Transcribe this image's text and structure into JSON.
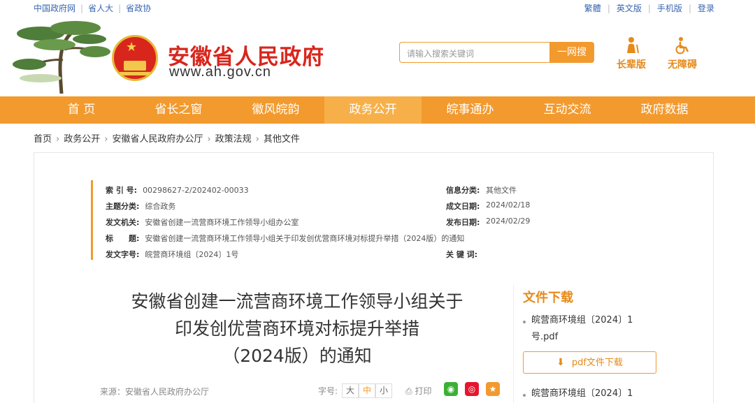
{
  "topbar": {
    "left_links": [
      "中国政府网",
      "省人大",
      "省政协"
    ],
    "right_links": [
      "繁體",
      "英文版",
      "手机版",
      "登录"
    ]
  },
  "header": {
    "site_title": "安徽省人民政府",
    "site_url": "www.ah.gov.cn",
    "search_placeholder": "请输入搜索关键词",
    "search_button": "一网搜",
    "elder_label": "长辈版",
    "accessible_label": "无障碍"
  },
  "nav": {
    "items": [
      "首 页",
      "省长之窗",
      "徽风皖韵",
      "政务公开",
      "皖事通办",
      "互动交流",
      "政府数据"
    ],
    "active": "政务公开"
  },
  "breadcrumb": [
    "首页",
    "政务公开",
    "安徽省人民政府办公厅",
    "政策法规",
    "其他文件"
  ],
  "meta": {
    "index_label": "索 引 号:",
    "index_value": "00298627-2/202402-00033",
    "category_label": "主题分类:",
    "category_value": "综合政务",
    "issuer_label": "发文机关:",
    "issuer_value": "安徽省创建一流营商环境工作领导小组办公室",
    "title_label": "标　　题:",
    "title_value": "安徽省创建一流营商环境工作领导小组关于印发创优营商环境对标提升举措（2024版）的通知",
    "docno_label": "发文字号:",
    "docno_value": "皖营商环境组〔2024〕1号",
    "info_cat_label": "信息分类:",
    "info_cat_value": "其他文件",
    "made_date_label": "成文日期:",
    "made_date_value": "2024/02/18",
    "pub_date_label": "发布日期:",
    "pub_date_value": "2024/02/29",
    "keywords_label": "关 键 词:",
    "keywords_value": ""
  },
  "document": {
    "title_lines": [
      "安徽省创建一流营商环境工作领导小组关于",
      "印发创优营商环境对标提升举措",
      "（2024版）的通知"
    ],
    "source": "来源：安徽省人民政府办公厅",
    "font_size_label": "字号:",
    "font_sizes": [
      "大",
      "中",
      "小"
    ],
    "font_size_active": "中",
    "print_label": "打印"
  },
  "download": {
    "title": "文件下载",
    "item1_line1": "皖营商环境组〔2024〕1",
    "item1_line2": "号.pdf",
    "button": "pdf文件下载",
    "item2_line1": "皖营商环境组〔2024〕1"
  },
  "colors": {
    "brand_red": "#d8261c",
    "accent_orange": "#f29a2e",
    "nav_active": "#f7b049",
    "link_blue": "#3a66b0"
  }
}
